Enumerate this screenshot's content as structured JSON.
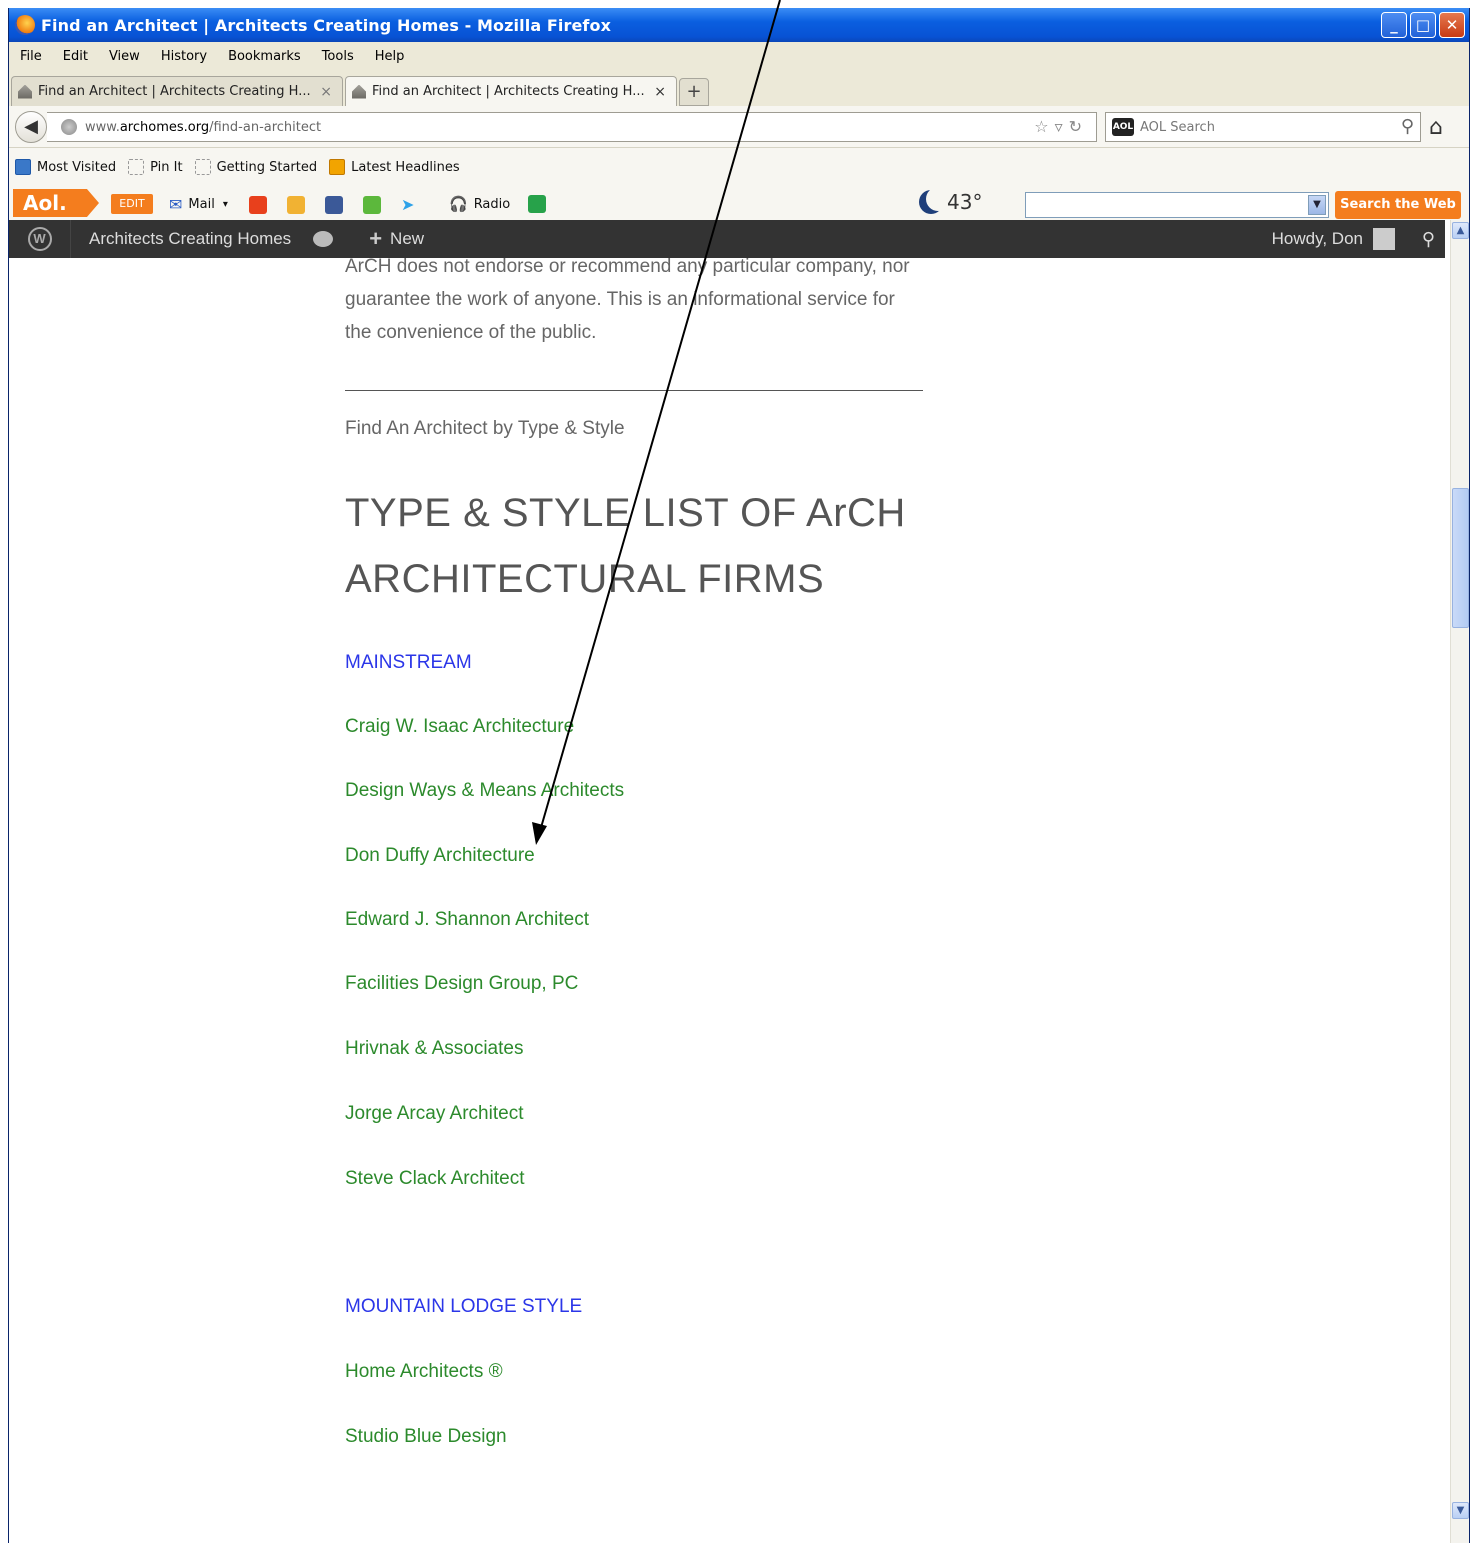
{
  "window": {
    "title": "Find an Architect | Architects Creating Homes - Mozilla Firefox",
    "controls": [
      "minimize",
      "maximize",
      "close"
    ]
  },
  "menubar": [
    "File",
    "Edit",
    "View",
    "History",
    "Bookmarks",
    "Tools",
    "Help"
  ],
  "tabs": [
    {
      "label": "Find an Architect | Architects Creating H...",
      "active": false
    },
    {
      "label": "Find an Architect | Architects Creating H...",
      "active": true
    }
  ],
  "navbar": {
    "url_prefix": "www.",
    "url_domain": "archomes.org",
    "url_path": "/find-an-architect",
    "search_placeholder": "AOL Search"
  },
  "bookmarks": [
    "Most Visited",
    "Pin It",
    "Getting Started",
    "Latest Headlines"
  ],
  "aol_toolbar": {
    "logo": "Aol.",
    "edit": "EDIT",
    "mail": "Mail",
    "radio": "Radio",
    "temperature": "43°",
    "search_button": "Search the Web"
  },
  "wp_admin": {
    "site_name": "Architects Creating Homes",
    "new_label": "New",
    "howdy": "Howdy, Don"
  },
  "page": {
    "intro_lines": [
      "ArCH does not endorse or recommend any particular company, nor",
      "guarantee the work of anyone.  This is an informational service for",
      "the convenience of the public."
    ],
    "find_by": "Find An Architect by Type & Style",
    "heading_line1": "TYPE & STYLE LIST OF ArCH",
    "heading_line2": "ARCHITECTURAL FIRMS",
    "categories": [
      {
        "name": "MAINSTREAM",
        "firms": [
          "Craig W. Isaac Architecture",
          "Design Ways & Means Architects",
          "Don Duffy Architecture",
          "Edward J. Shannon Architect",
          "Facilities Design Group, PC",
          "Hrivnak & Associates",
          "Jorge Arcay Architect",
          "Steve Clack Architect"
        ]
      },
      {
        "name": "MOUNTAIN LODGE STYLE",
        "firms": [
          "Home Architects ®",
          "Studio Blue Design"
        ]
      }
    ]
  },
  "colors": {
    "category_link": "#2b36e8",
    "firm_link": "#2c8a2c",
    "body_text": "#666666",
    "wp_bar": "#333333",
    "aol_orange": "#f47d1e"
  }
}
